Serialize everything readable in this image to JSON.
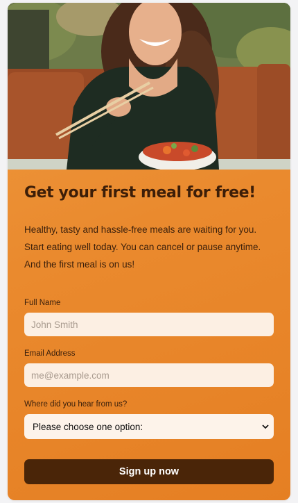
{
  "hero": {
    "image_alt": "Smiling woman eating a salad with chopsticks"
  },
  "headline": "Get your first meal for free!",
  "intro": "Healthy, tasty and hassle-free meals are waiting for you. Start eating well today. You can cancel or pause anytime. And the first meal is on us!",
  "form": {
    "full_name": {
      "label": "Full Name",
      "placeholder": "John Smith",
      "value": ""
    },
    "email": {
      "label": "Email Address",
      "placeholder": "me@example.com",
      "value": ""
    },
    "source": {
      "label": "Where did you hear from us?",
      "selected": "Please choose one option:"
    },
    "submit_label": "Sign up now"
  },
  "colors": {
    "card_gradient_start": "#ee9a40",
    "card_gradient_end": "#e57f23",
    "title_text": "#3d1e08",
    "input_bg": "#fcefe3",
    "button_bg": "#4a2508",
    "button_text": "#ffffff"
  },
  "icons": {
    "select_chevron": "chevron-down-icon"
  }
}
